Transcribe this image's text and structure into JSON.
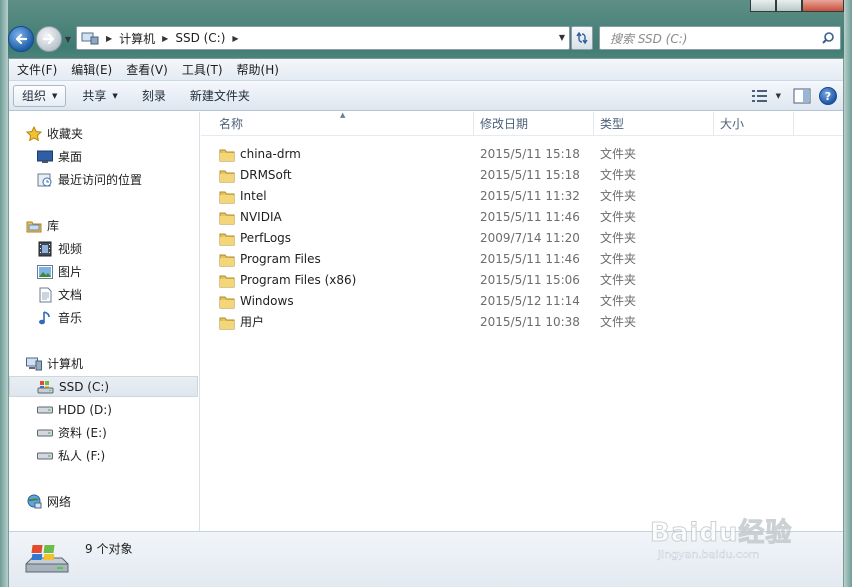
{
  "window": {
    "caption_buttons": [
      "minimize",
      "maximize",
      "close"
    ]
  },
  "address": {
    "crumbs": [
      "计算机",
      "SSD (C:)"
    ],
    "search_placeholder": "搜索 SSD (C:)"
  },
  "menubar": {
    "items": [
      "文件(F)",
      "编辑(E)",
      "查看(V)",
      "工具(T)",
      "帮助(H)"
    ]
  },
  "toolbar": {
    "organize": "组织",
    "share": "共享",
    "burn": "刻录",
    "new_folder": "新建文件夹"
  },
  "nav": {
    "favorites": "收藏夹",
    "desktop": "桌面",
    "recent": "最近访问的位置",
    "libraries": "库",
    "videos": "视频",
    "pictures": "图片",
    "documents": "文档",
    "music": "音乐",
    "computer": "计算机",
    "drive_c": "SSD (C:)",
    "drive_d": "HDD (D:)",
    "drive_e": "资料 (E:)",
    "drive_f": "私人 (F:)",
    "network": "网络"
  },
  "columns": {
    "name": "名称",
    "modified": "修改日期",
    "type": "类型",
    "size": "大小"
  },
  "files": [
    {
      "name": "china-drm",
      "modified": "2015/5/11 15:18",
      "type": "文件夹",
      "size": ""
    },
    {
      "name": "DRMSoft",
      "modified": "2015/5/11 15:18",
      "type": "文件夹",
      "size": ""
    },
    {
      "name": "Intel",
      "modified": "2015/5/11 11:32",
      "type": "文件夹",
      "size": ""
    },
    {
      "name": "NVIDIA",
      "modified": "2015/5/11 11:46",
      "type": "文件夹",
      "size": ""
    },
    {
      "name": "PerfLogs",
      "modified": "2009/7/14 11:20",
      "type": "文件夹",
      "size": ""
    },
    {
      "name": "Program Files",
      "modified": "2015/5/11 11:46",
      "type": "文件夹",
      "size": ""
    },
    {
      "name": "Program Files (x86)",
      "modified": "2015/5/11 15:06",
      "type": "文件夹",
      "size": ""
    },
    {
      "name": "Windows",
      "modified": "2015/5/12 11:14",
      "type": "文件夹",
      "size": ""
    },
    {
      "name": "用户",
      "modified": "2015/5/11 10:38",
      "type": "文件夹",
      "size": ""
    }
  ],
  "status": {
    "count": "9 个对象"
  },
  "watermark": {
    "main": "Baidu经验",
    "sub": "jingyan.baidu.com"
  },
  "colors": {
    "folder": "#e8c25a",
    "selection": "#dfe6ee",
    "header_text": "#4c607a"
  }
}
